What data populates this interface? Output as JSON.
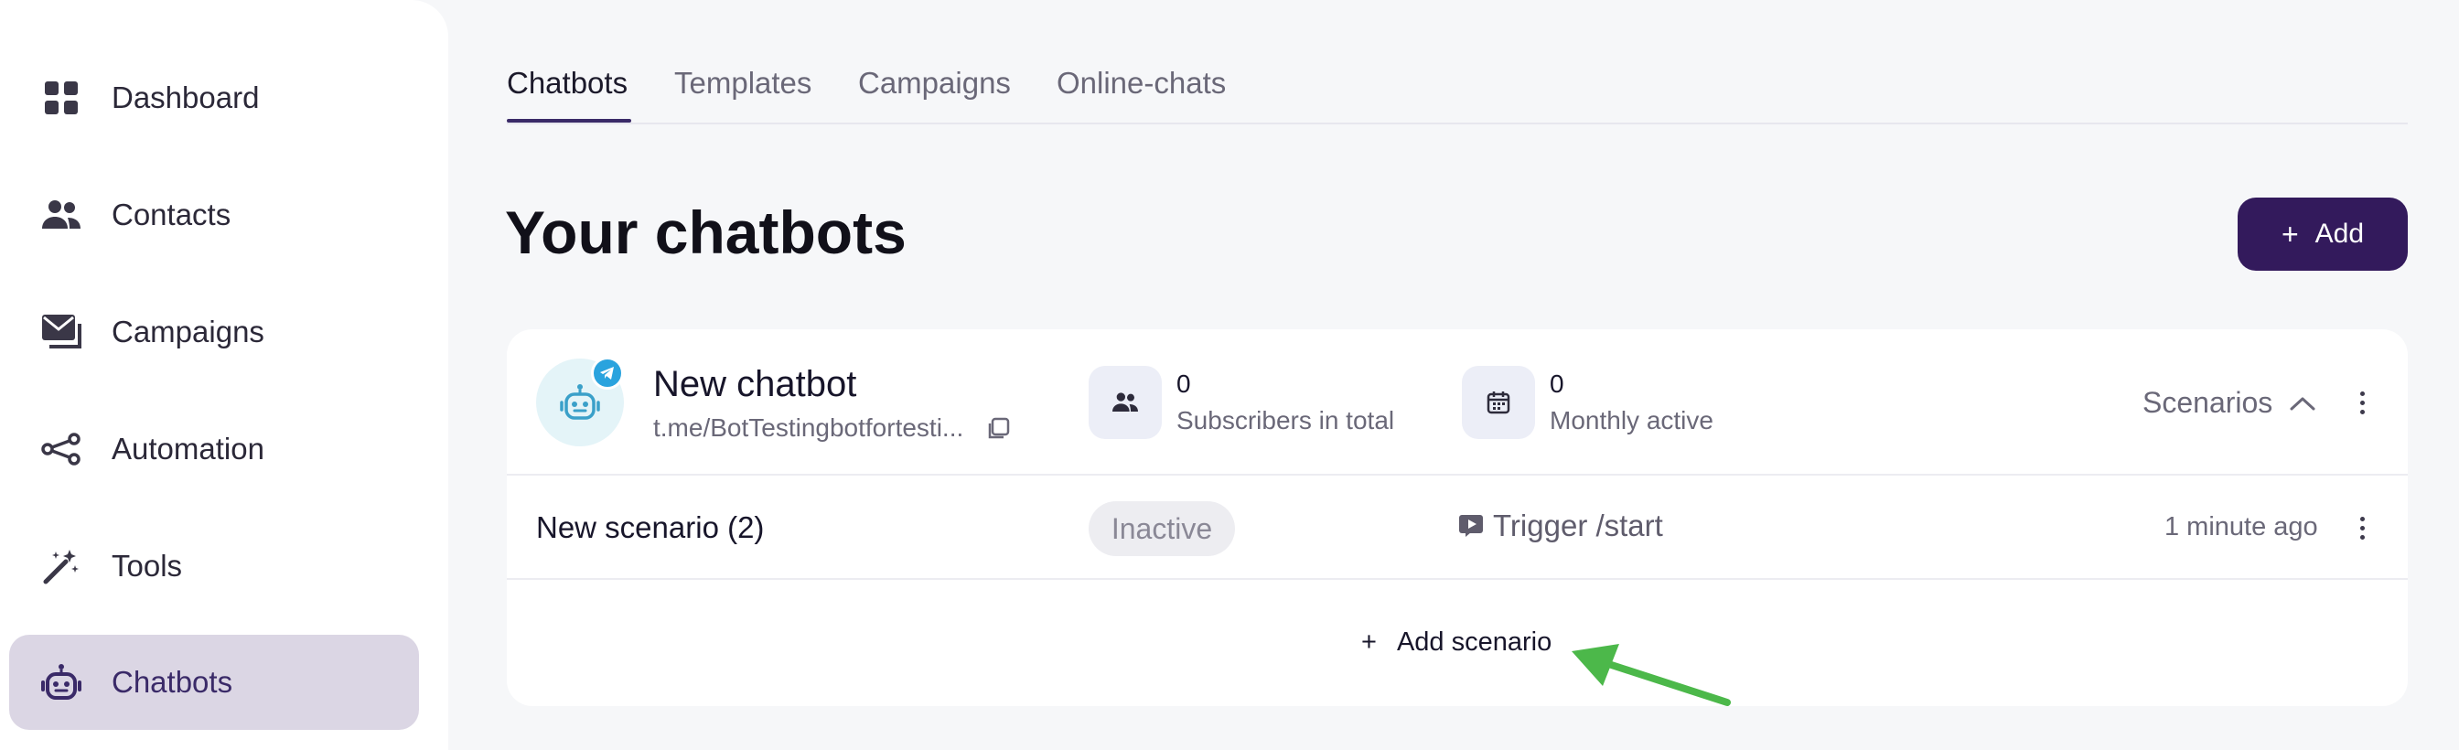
{
  "sidebar": {
    "items": [
      {
        "label": "Dashboard",
        "icon": "dashboard-grid-icon"
      },
      {
        "label": "Contacts",
        "icon": "people-icon"
      },
      {
        "label": "Campaigns",
        "icon": "mail-icon"
      },
      {
        "label": "Automation",
        "icon": "share-nodes-icon"
      },
      {
        "label": "Tools",
        "icon": "magic-wand-icon"
      },
      {
        "label": "Chatbots",
        "icon": "robot-icon",
        "active": true
      }
    ]
  },
  "tabs": [
    {
      "label": "Chatbots",
      "active": true
    },
    {
      "label": "Templates"
    },
    {
      "label": "Campaigns"
    },
    {
      "label": "Online-chats"
    }
  ],
  "page_title": "Your chatbots",
  "add_button": {
    "plus": "+",
    "label": "Add"
  },
  "chatbot": {
    "name": "New chatbot",
    "link": "t.me/BotTestingbotfortesti...",
    "stats": [
      {
        "value": "0",
        "label": "Subscribers in total",
        "icon": "people-icon"
      },
      {
        "value": "0",
        "label": "Monthly active",
        "icon": "calendar-icon"
      }
    ],
    "scenarios_toggle": "Scenarios",
    "scenarios": [
      {
        "name": "New scenario (2)",
        "status": "Inactive",
        "trigger": "Trigger /start",
        "time": "1 minute ago"
      }
    ],
    "add_scenario": {
      "plus": "+",
      "label": "Add scenario"
    }
  },
  "colors": {
    "accent": "#331a5c",
    "active_nav_bg": "#dbd6e4",
    "telegram": "#2aa3de",
    "annotation_arrow": "#4cb84a"
  }
}
